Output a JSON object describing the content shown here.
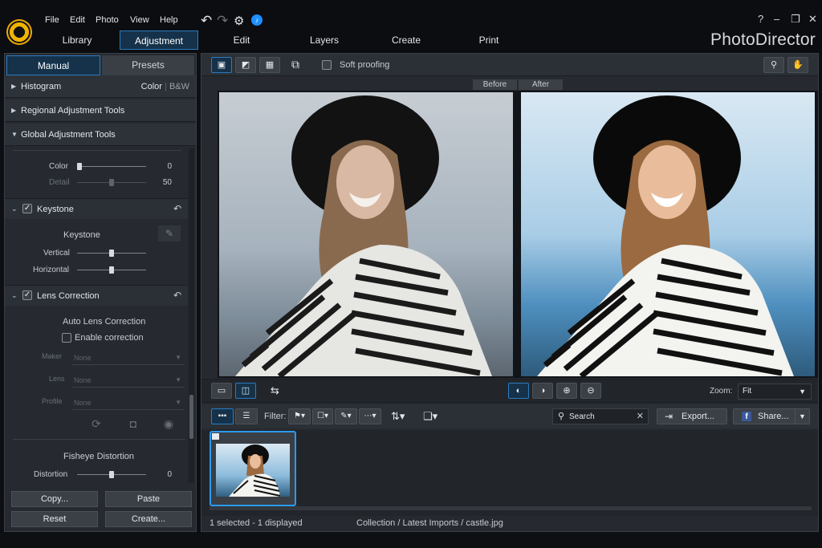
{
  "app": {
    "name": "PhotoDirector",
    "menu": [
      "File",
      "Edit",
      "Photo",
      "View",
      "Help"
    ],
    "modules": [
      "Library",
      "Adjustment",
      "Edit",
      "Layers",
      "Create",
      "Print"
    ],
    "active_module": "Adjustment",
    "window_buttons": [
      "?",
      "–",
      "❐",
      "✕"
    ]
  },
  "left_panel": {
    "tabs": [
      "Manual",
      "Presets"
    ],
    "active_tab": "Manual",
    "sections": {
      "histogram": "Histogram",
      "color_mode": "Color",
      "bw_mode": "B&W",
      "regional": "Regional Adjustment Tools",
      "global": "Global Adjustment Tools"
    },
    "noise": {
      "color_label": "Color",
      "color_value": "0",
      "color_level": 0,
      "detail_label": "Detail",
      "detail_value": "50",
      "detail_level": 0.5
    },
    "keystone": {
      "header": "Keystone",
      "enabled": true,
      "sub_title": "Keystone",
      "vertical_label": "Vertical",
      "vertical_level": 0.5,
      "horizontal_label": "Horizontal",
      "horizontal_level": 0.5
    },
    "lens": {
      "header": "Lens Correction",
      "enabled": true,
      "auto_title": "Auto Lens Correction",
      "enable_correction_label": "Enable correction",
      "enable_correction": false,
      "maker_label": "Maker",
      "maker_value": "None",
      "lens_label": "Lens",
      "lens_value": "None",
      "profile_label": "Profile",
      "profile_value": "None",
      "fisheye_title": "Fisheye Distortion",
      "distortion_label": "Distortion",
      "distortion_value": "0",
      "distortion_level": 0.5
    },
    "buttons": {
      "copy": "Copy...",
      "paste": "Paste",
      "reset": "Reset",
      "create": "Create..."
    }
  },
  "toolbar": {
    "soft_proofing_label": "Soft proofing",
    "soft_proofing": false
  },
  "viewer": {
    "before_label": "Before",
    "after_label": "After"
  },
  "viewbar": {
    "zoom_label": "Zoom:",
    "zoom_value": "Fit"
  },
  "filterbar": {
    "filter_label": "Filter:",
    "search_placeholder": "Search",
    "export_label": "Export...",
    "share_label": "Share..."
  },
  "status": {
    "selection": "1 selected - 1 displayed",
    "path": "Collection / Latest Imports / castle.jpg"
  },
  "colors": {
    "accent": "#2b9bf0",
    "active_tab_bg": "#15324a",
    "panel_bg": "#262a30"
  }
}
